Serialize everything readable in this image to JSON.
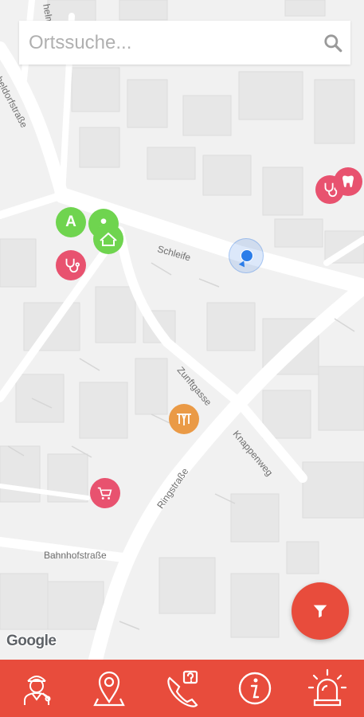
{
  "search": {
    "placeholder": "Ortssuche..."
  },
  "map": {
    "streets": {
      "schleife": "Schleife",
      "zunftgasse": "Zunftgasse",
      "knappenweg": "Knappenweg",
      "ringstrasse": "Ringstraße",
      "bahnhofstrasse": "Bahnhofstraße",
      "heldorfstrasse": "heldorfstraße",
      "top_partial": "helm"
    },
    "attribution": "Google",
    "pois": [
      {
        "id": "doctor-1",
        "category": "doctor",
        "icon": "stethoscope-icon",
        "color": "#e8526f"
      },
      {
        "id": "dentist",
        "category": "dentist",
        "icon": "tooth-icon",
        "color": "#e8526f"
      },
      {
        "id": "pharmacy",
        "category": "pharmacy",
        "icon": "letter-a-icon",
        "letter": "A",
        "color": "#6fd44f"
      },
      {
        "id": "caregiver",
        "category": "care",
        "icon": "person-icon",
        "color": "#6fd44f"
      },
      {
        "id": "care-home",
        "category": "care",
        "icon": "house-icon",
        "color": "#6fd44f"
      },
      {
        "id": "doctor-2",
        "category": "doctor",
        "icon": "stethoscope-icon",
        "color": "#e8526f"
      },
      {
        "id": "physio",
        "category": "therapy",
        "icon": "massage-icon",
        "color": "#ea9a46"
      },
      {
        "id": "shop",
        "category": "shopping",
        "icon": "cart-icon",
        "color": "#e8526f"
      }
    ]
  },
  "colors": {
    "accent": "#e84c3c",
    "poi_red": "#e8526f",
    "poi_green": "#6fd44f",
    "poi_orange": "#ea9a46",
    "user_location": "#2b7de9"
  },
  "nav": [
    {
      "id": "profile",
      "icon": "doctor-avatar-icon"
    },
    {
      "id": "map",
      "icon": "map-pin-icon"
    },
    {
      "id": "hotline",
      "icon": "phone-question-icon"
    },
    {
      "id": "info",
      "icon": "info-icon"
    },
    {
      "id": "emergency",
      "icon": "siren-icon"
    }
  ]
}
